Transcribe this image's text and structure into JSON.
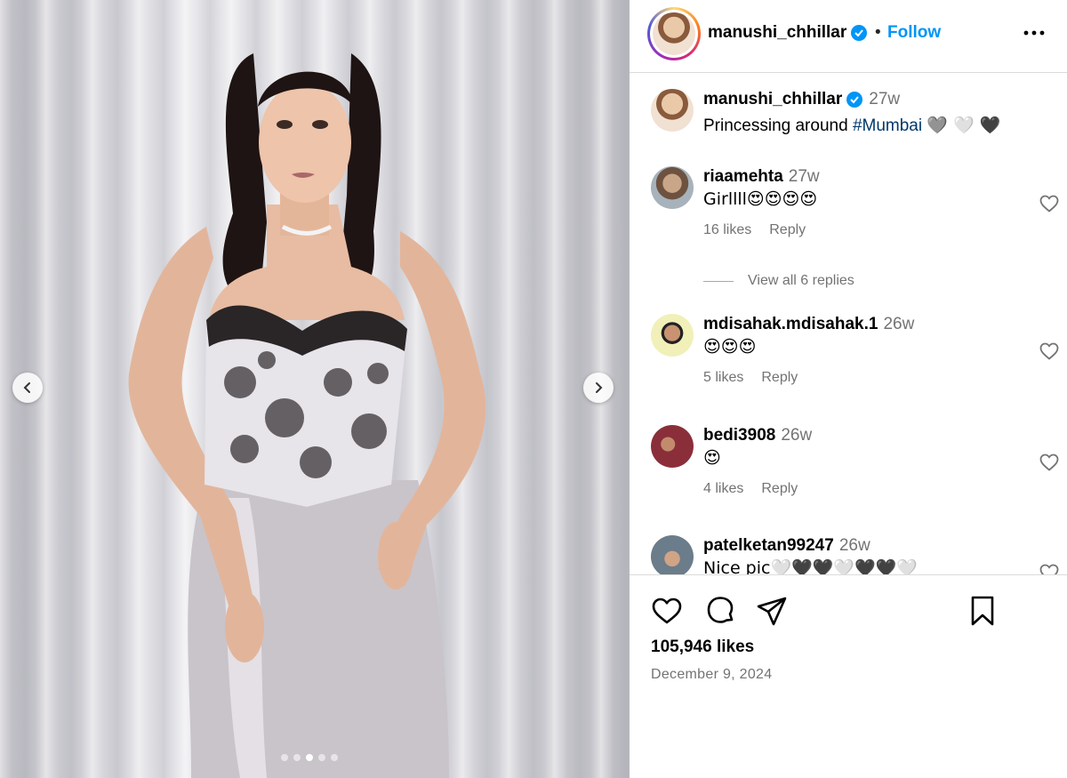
{
  "post": {
    "username": "manushi_chhillar",
    "follow_label": "Follow",
    "separator": "•",
    "more_icon": "more-horizontal-icon",
    "caption": {
      "username": "manushi_chhillar",
      "time": "27w",
      "text": "Princessing around ",
      "hashtag": "#Mumbai",
      "emojis": "🩶 🤍 🖤"
    },
    "carousel": {
      "total_slides": 5,
      "active_slide": 3
    }
  },
  "comments": [
    {
      "username": "riaamehta",
      "time": "27w",
      "text": "Girllll😍😍😍😍",
      "likes": "16 likes",
      "reply_label": "Reply"
    },
    {
      "username": "mdisahak.mdisahak.1",
      "time": "26w",
      "text": "😍😍😍",
      "likes": "5 likes",
      "reply_label": "Reply"
    },
    {
      "username": "bedi3908",
      "time": "26w",
      "text": "😍",
      "likes": "4 likes",
      "reply_label": "Reply"
    },
    {
      "username": "patelketan99247",
      "time": "26w",
      "text": "Nice pic🤍🖤🖤🤍🖤🖤🤍"
    }
  ],
  "replies_label": "View all 6 replies",
  "footer": {
    "likes": "105,946 likes",
    "date": "December 9, 2024"
  },
  "colors": {
    "accent": "#0095f6",
    "verified": "#0095f6",
    "hashtag": "#00376b",
    "muted": "#737373",
    "divider": "#dbdbdb"
  }
}
